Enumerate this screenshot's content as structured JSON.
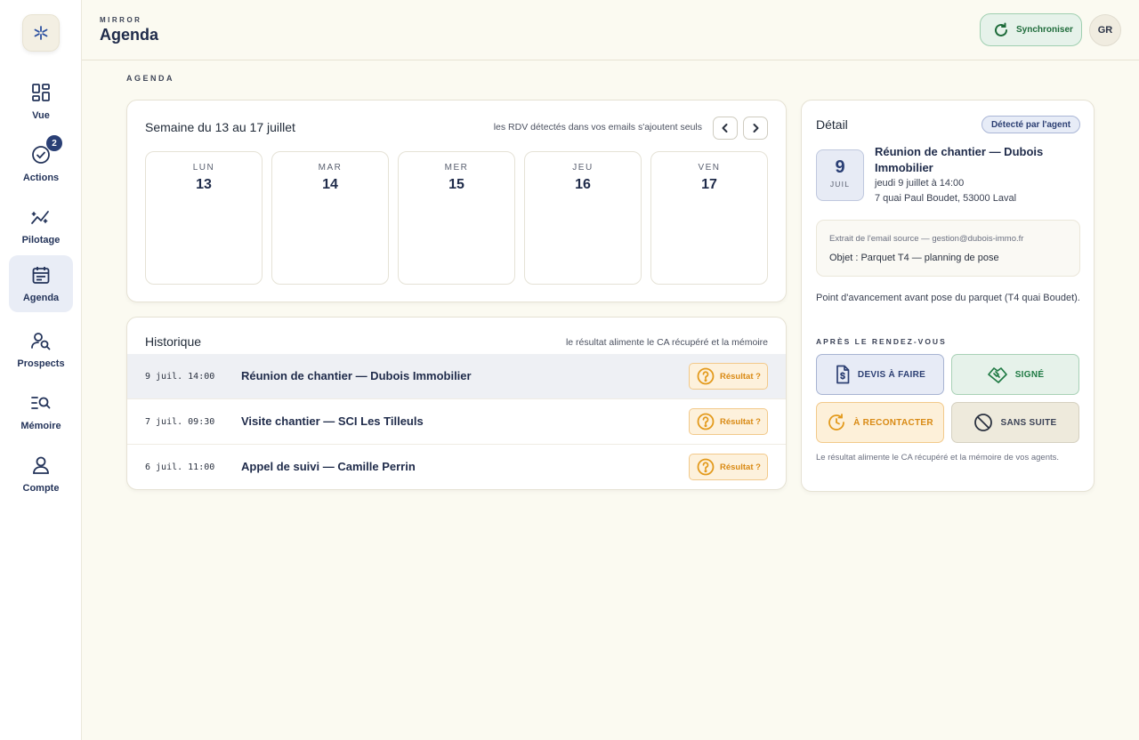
{
  "app": {
    "kicker": "MIRROR",
    "title": "Agenda"
  },
  "header": {
    "sync_label": "Synchroniser",
    "avatar_initials": "GR"
  },
  "sidebar": {
    "items": [
      {
        "label": "Vue",
        "icon": "dashboard-icon"
      },
      {
        "label": "Actions",
        "icon": "check-circle-icon",
        "badge": "2"
      },
      {
        "label": "Pilotage",
        "icon": "trend-chart-icon"
      },
      {
        "label": "Agenda",
        "icon": "calendar-icon",
        "active": true
      },
      {
        "label": "Prospects",
        "icon": "user-search-icon"
      },
      {
        "label": "Mémoire",
        "icon": "list-search-icon"
      },
      {
        "label": "Compte",
        "icon": "user-icon"
      }
    ]
  },
  "section_kicker": "AGENDA",
  "week": {
    "title": "Semaine du 13 au 17 juillet",
    "hint": "les RDV détectés dans vos emails s'ajoutent seuls",
    "days": [
      {
        "name": "LUN",
        "date": "13"
      },
      {
        "name": "MAR",
        "date": "14"
      },
      {
        "name": "MER",
        "date": "15"
      },
      {
        "name": "JEU",
        "date": "16"
      },
      {
        "name": "VEN",
        "date": "17"
      }
    ]
  },
  "history": {
    "title": "Historique",
    "hint": "le résultat alimente le CA récupéré et la mémoire",
    "result_label": "Résultat ?",
    "rows": [
      {
        "time": "9 juil. 14:00",
        "title": "Réunion de chantier — Dubois Immobilier",
        "selected": true
      },
      {
        "time": "7 juil. 09:30",
        "title": "Visite chantier — SCI Les Tilleuls"
      },
      {
        "time": "6 juil. 11:00",
        "title": "Appel de suivi — Camille Perrin"
      }
    ]
  },
  "detail": {
    "title": "Détail",
    "badge": "Détecté par l'agent",
    "date_day": "9",
    "date_month": "JUIL",
    "event_title": "Réunion de chantier — Dubois Immobilier",
    "when": "jeudi 9 juillet à 14:00",
    "where": "7 quai Paul Boudet, 53000 Laval",
    "excerpt_source": "Extrait de l'email source — gestion@dubois-immo.fr",
    "excerpt_subject": "Objet : Parquet T4 — planning de pose",
    "description": "Point d'avancement avant pose du parquet (T4 quai Boudet).",
    "after_label": "APRÈS LE RENDEZ-VOUS",
    "actions": {
      "devis": "DEVIS À FAIRE",
      "signe": "SIGNÉ",
      "recontacter": "À RECONTACTER",
      "sans_suite": "SANS SUITE"
    },
    "footnote": "Le résultat alimente le CA récupéré et la mémoire de vos agents."
  },
  "colors": {
    "accent": "#2a3f75",
    "success": "#1f7a44",
    "warning": "#d98a14",
    "background": "#fbfaf1"
  }
}
